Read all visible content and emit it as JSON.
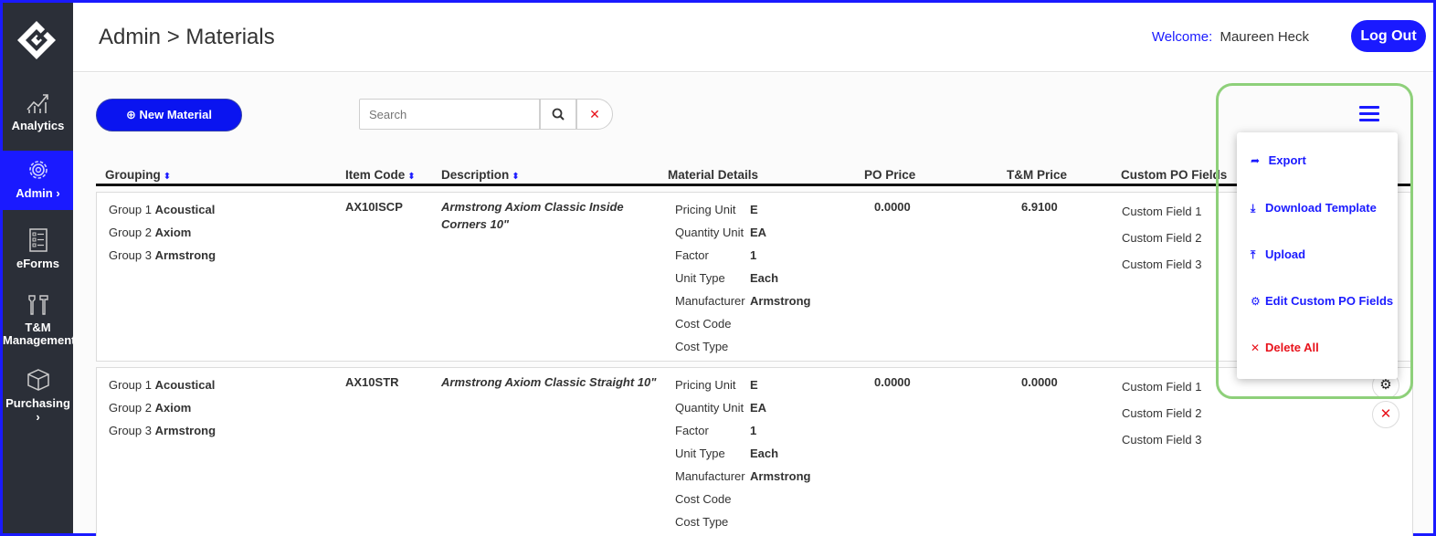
{
  "sidebar": {
    "logo": "company-logo",
    "items": [
      {
        "label": "Analytics",
        "icon": "chart-line-icon"
      },
      {
        "label": "Admin",
        "icon": "gear-icon",
        "active": true
      },
      {
        "label": "eForms",
        "icon": "form-icon"
      },
      {
        "label": "T&M Management",
        "icon": "tools-icon"
      },
      {
        "label": "Purchasing",
        "icon": "box-icon"
      }
    ]
  },
  "header": {
    "title": "Admin > Materials",
    "welcome_label": "Welcome:",
    "user_name": "Maureen Heck",
    "logout_label": "Log Out"
  },
  "toolbar": {
    "new_label": "New Material",
    "search_placeholder": "Search",
    "search_value": ""
  },
  "table": {
    "headers": [
      "Grouping",
      "Item Code",
      "Description",
      "Material Details",
      "PO Price",
      "T&M Price",
      "Custom PO Fields"
    ],
    "rows": [
      {
        "groups": [
          [
            "Group 1",
            "Acoustical"
          ],
          [
            "Group 2",
            "Axiom"
          ],
          [
            "Group 3",
            "Armstrong"
          ]
        ],
        "item_code": "AX10ISCP",
        "description": "Armstrong Axiom Classic Inside Corners 10\"",
        "details": [
          [
            "Pricing Unit",
            "E"
          ],
          [
            "Quantity Unit",
            "EA"
          ],
          [
            "Factor",
            "1"
          ],
          [
            "Unit Type",
            "Each"
          ],
          [
            "Manufacturer",
            "Armstrong"
          ],
          [
            "Cost Code",
            ""
          ],
          [
            "Cost Type",
            ""
          ]
        ],
        "po_price": "0.0000",
        "tm_price": "6.9100",
        "custom_fields": [
          "Custom Field 1",
          "Custom Field 2",
          "Custom Field 3"
        ]
      },
      {
        "groups": [
          [
            "Group 1",
            "Acoustical"
          ],
          [
            "Group 2",
            "Axiom"
          ],
          [
            "Group 3",
            "Armstrong"
          ]
        ],
        "item_code": "AX10STR",
        "description": "Armstrong Axiom Classic Straight 10\"",
        "details": [
          [
            "Pricing Unit",
            "E"
          ],
          [
            "Quantity Unit",
            "EA"
          ],
          [
            "Factor",
            "1"
          ],
          [
            "Unit Type",
            "Each"
          ],
          [
            "Manufacturer",
            "Armstrong"
          ],
          [
            "Cost Code",
            ""
          ],
          [
            "Cost Type",
            ""
          ]
        ],
        "po_price": "0.0000",
        "tm_price": "0.0000",
        "custom_fields": [
          "Custom Field 1",
          "Custom Field 2",
          "Custom Field 3"
        ]
      }
    ]
  },
  "menu": {
    "items": [
      {
        "label": "Export",
        "icon": "share-icon"
      },
      {
        "label": "Download Template",
        "icon": "download-icon"
      },
      {
        "label": "Upload",
        "icon": "upload-icon"
      },
      {
        "label": "Edit Custom PO Fields",
        "icon": "gear-icon"
      },
      {
        "label": "Delete All",
        "icon": "close-icon"
      }
    ]
  },
  "colors": {
    "accent": "#1a1aff",
    "sidebar": "#2b2f38",
    "danger": "#e8121b",
    "highlight": "#8ed07a"
  }
}
